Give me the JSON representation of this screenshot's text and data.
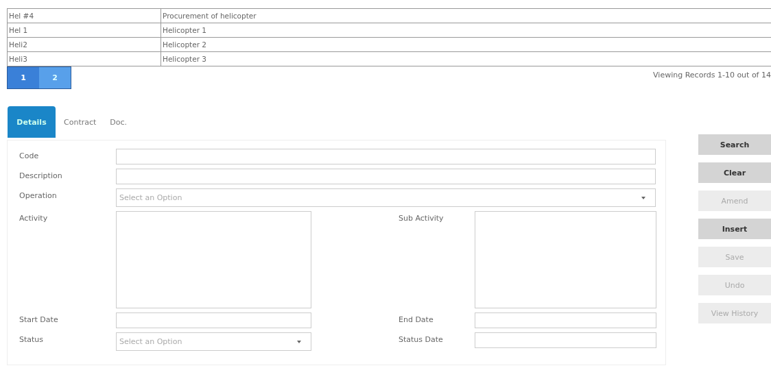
{
  "table": {
    "rows": [
      {
        "code": "Hel #4",
        "description": "Procurement of helicopter"
      },
      {
        "code": "Hel 1",
        "description": "Helicopter 1"
      },
      {
        "code": "Heli2",
        "description": "Helicopter 2"
      },
      {
        "code": "Heli3",
        "description": "Helicopter 3"
      }
    ]
  },
  "pagination": {
    "pages": [
      {
        "label": "1",
        "selected": true
      },
      {
        "label": "2",
        "selected": false
      }
    ]
  },
  "record_summary": "Viewing Records 1-10 out of 14",
  "tabs": [
    {
      "label": "Details",
      "selected": true
    },
    {
      "label": "Contract",
      "selected": false
    },
    {
      "label": "Doc.",
      "selected": false
    }
  ],
  "form": {
    "rows": [
      [
        {
          "label": "Code",
          "kind": "text"
        }
      ],
      [
        {
          "label": "Description",
          "kind": "text"
        }
      ],
      [
        {
          "label": "Operation",
          "kind": "select",
          "placeholder": "Select an Option"
        }
      ],
      [
        {
          "label": "Activity",
          "kind": "textarea"
        },
        {
          "label": "Sub Activity",
          "kind": "textarea"
        }
      ],
      [
        {
          "label": "Start Date",
          "kind": "text"
        },
        {
          "label": "End Date",
          "kind": "text"
        }
      ],
      [
        {
          "label": "Status",
          "kind": "select",
          "placeholder": "Select an Option"
        },
        {
          "label": "Status Date",
          "kind": "text"
        }
      ]
    ]
  },
  "buttons": [
    {
      "label": "Search",
      "disabled": false
    },
    {
      "label": "Clear",
      "disabled": false
    },
    {
      "label": "Amend",
      "disabled": true
    },
    {
      "label": "Insert",
      "disabled": false
    },
    {
      "label": "Save",
      "disabled": true
    },
    {
      "label": "Undo",
      "disabled": true
    },
    {
      "label": "View History",
      "disabled": true
    }
  ]
}
